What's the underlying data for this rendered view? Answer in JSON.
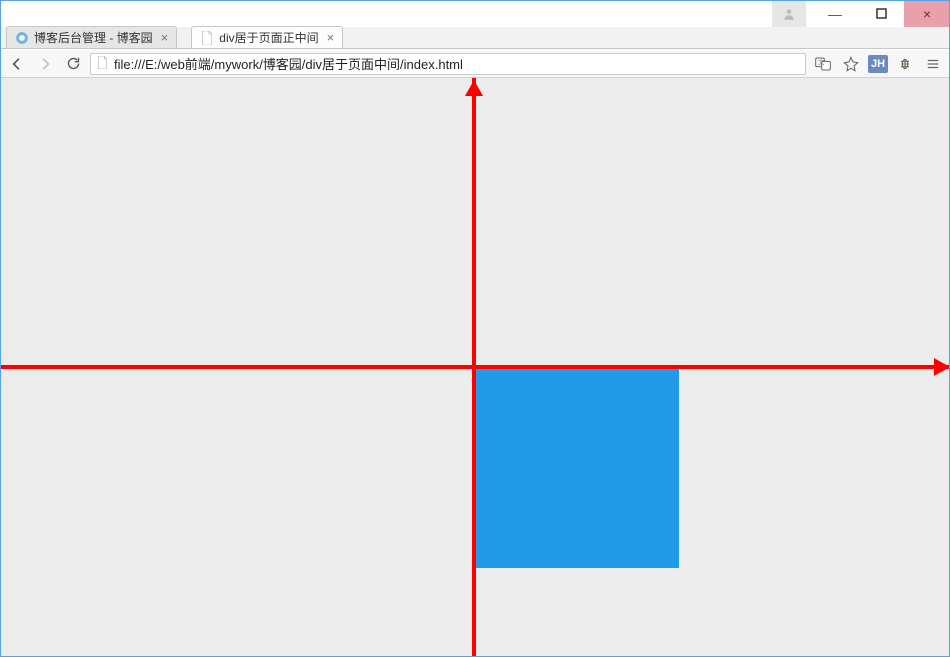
{
  "window": {
    "user_icon": "user-icon",
    "min_label": "—",
    "close_label": "×"
  },
  "tabs": [
    {
      "label": "博客后台管理 - 博客园",
      "favicon": "cnblogs-icon",
      "active": false
    },
    {
      "label": "div居于页面正中间",
      "favicon": "file-icon",
      "active": true
    }
  ],
  "toolbar": {
    "url": "file:///E:/web前端/mywork/博客园/div居于页面中间/index.html"
  },
  "extensions": {
    "translate": "translate-icon",
    "star": "star-icon",
    "jh_label": "JH",
    "bug": "bug-icon",
    "menu": "menu-icon"
  },
  "content": {
    "box_color": "#219be8",
    "axis_color": "#ff0000"
  }
}
